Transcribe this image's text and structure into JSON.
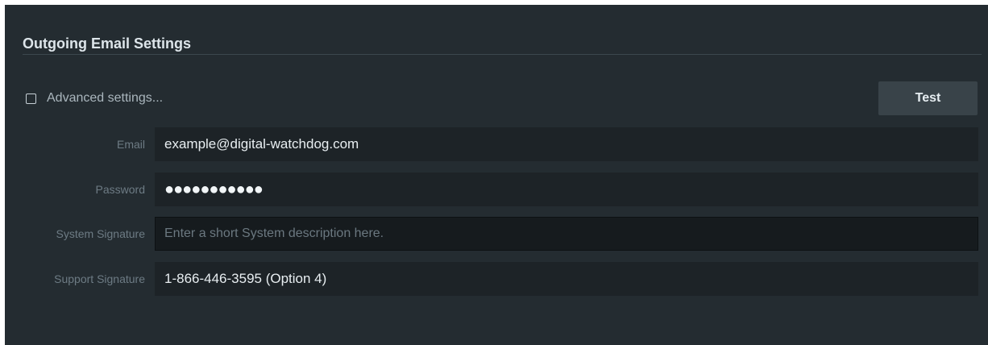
{
  "section": {
    "title": "Outgoing Email Settings"
  },
  "advanced": {
    "label": "Advanced settings...",
    "checked": false
  },
  "test_button": {
    "label": "Test"
  },
  "fields": {
    "email": {
      "label": "Email",
      "value": "example@digital-watchdog.com"
    },
    "password": {
      "label": "Password",
      "masked_value": "●●●●●●●●●●●"
    },
    "system_signature": {
      "label": "System Signature",
      "placeholder": "Enter a short System description here.",
      "value": ""
    },
    "support_signature": {
      "label": "Support Signature",
      "value": "1-866-446-3595 (Option 4)"
    }
  },
  "colors": {
    "panel_background": "#242c31",
    "input_background": "#1d2327",
    "button_background": "#394349",
    "label_color": "#6d7b84"
  }
}
